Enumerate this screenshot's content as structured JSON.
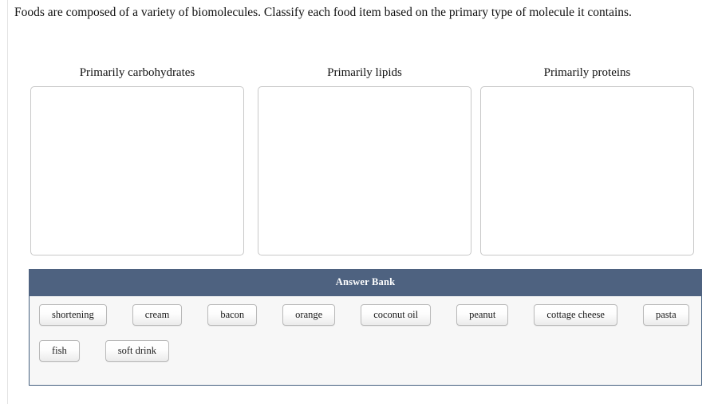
{
  "prompt": {
    "text": "Foods are composed of a variety of biomolecules. Classify each food item based on the primary type of molecule it contains."
  },
  "categories": [
    {
      "label": "Primarily carbohydrates"
    },
    {
      "label": "Primarily lipids"
    },
    {
      "label": "Primarily proteins"
    }
  ],
  "answer_bank": {
    "title": "Answer Bank",
    "header_color": "#4e6280",
    "body_color": "#f7f7f7",
    "border_color": "#45607f",
    "rows": [
      [
        {
          "label": "shortening"
        },
        {
          "label": "cream"
        },
        {
          "label": "bacon"
        },
        {
          "label": "orange"
        },
        {
          "label": "coconut oil"
        },
        {
          "label": "peanut"
        },
        {
          "label": "cottage cheese"
        },
        {
          "label": "pasta"
        }
      ],
      [
        {
          "label": "fish"
        },
        {
          "label": "soft drink"
        }
      ]
    ]
  }
}
